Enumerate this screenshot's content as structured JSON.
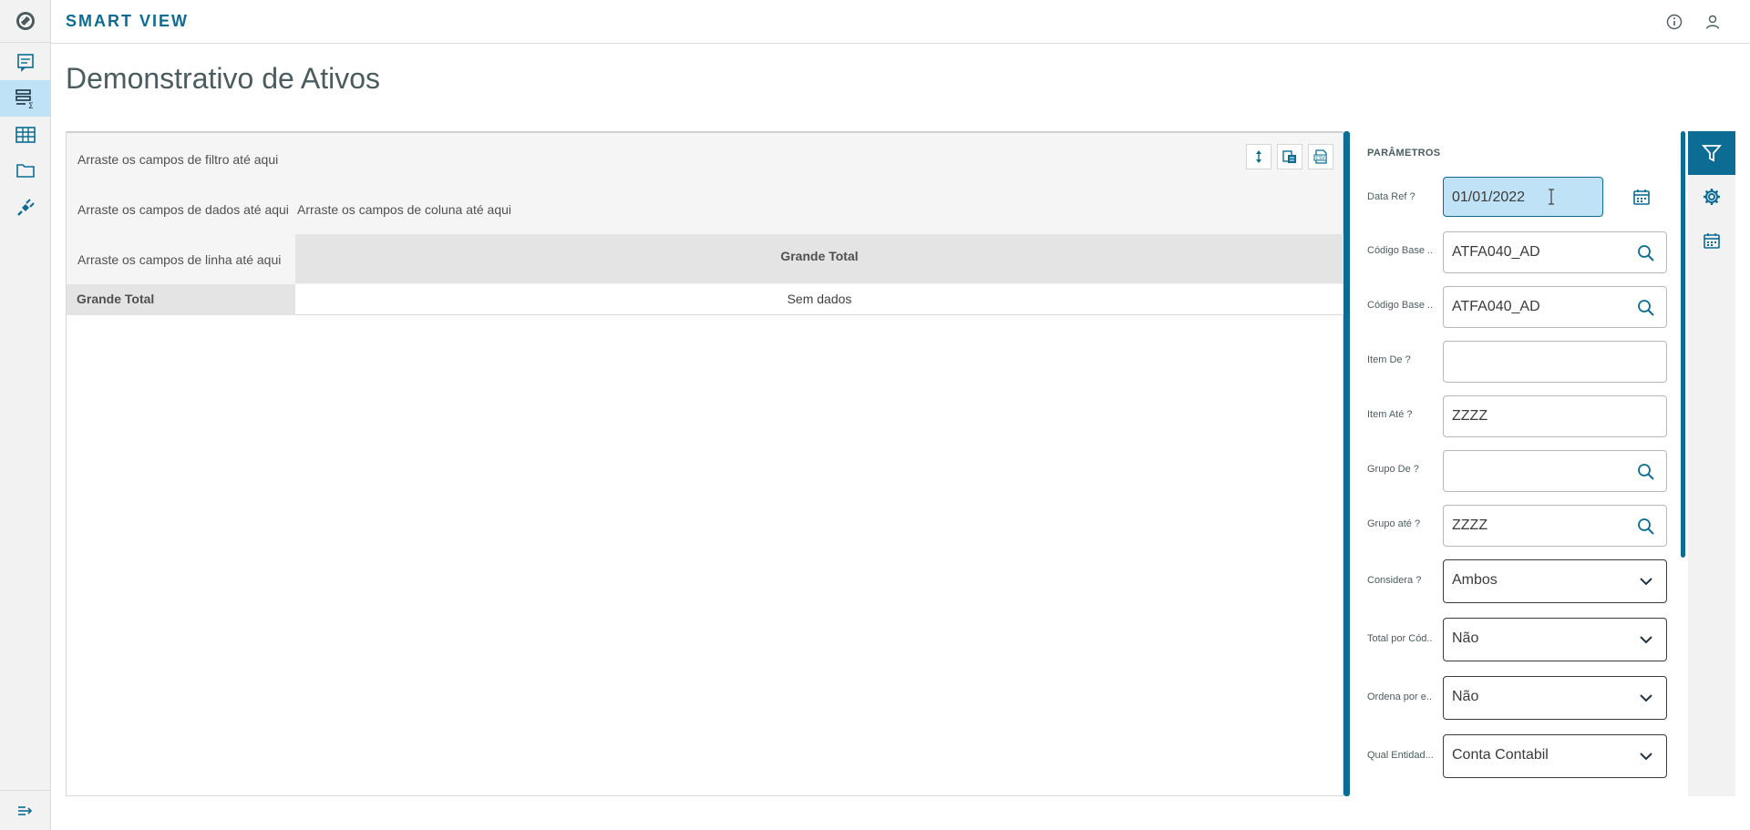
{
  "app": {
    "brand": "SMART VIEW"
  },
  "rail": {
    "items": [
      {
        "icon": "report-icon",
        "active": false
      },
      {
        "icon": "analysis-icon",
        "active": true
      },
      {
        "icon": "table-icon",
        "active": false
      },
      {
        "icon": "folder-icon",
        "active": false
      },
      {
        "icon": "plug-icon",
        "active": false
      }
    ],
    "bottom_icon": "expand-menu-icon"
  },
  "topbar": {
    "icons": [
      "info-icon",
      "user-icon"
    ]
  },
  "page": {
    "title": "Demonstrativo de Ativos"
  },
  "pivot": {
    "filter_drop": "Arraste os campos de filtro até aqui",
    "data_drop": "Arraste os campos de dados até aqui",
    "column_drop": "Arraste os campos de coluna até aqui",
    "row_drop": "Arraste os campos de linha até aqui",
    "grand_total_col": "Grande Total",
    "grand_total_row": "Grande Total",
    "no_data": "Sem dados",
    "tools": [
      "field-chooser-icon",
      "export-icon",
      "csv-icon"
    ]
  },
  "params": {
    "title": "PARÂMETROS",
    "fields": [
      {
        "label": "Data Ref ?",
        "value": "01/01/2022",
        "kind": "date"
      },
      {
        "label": "Código Base ...",
        "value": "ATFA040_AD",
        "kind": "lookup"
      },
      {
        "label": "Código Base ...",
        "value": "ATFA040_AD",
        "kind": "lookup"
      },
      {
        "label": "Item De ?",
        "value": "",
        "kind": "text"
      },
      {
        "label": "Item Até ?",
        "value": "ZZZZ",
        "kind": "text"
      },
      {
        "label": "Grupo De ?",
        "value": "",
        "kind": "lookup"
      },
      {
        "label": "Grupo até ?",
        "value": "ZZZZ",
        "kind": "lookup"
      },
      {
        "label": "Considera ?",
        "value": "Ambos",
        "kind": "select"
      },
      {
        "label": "Total por Cód...",
        "value": "Não",
        "kind": "select"
      },
      {
        "label": "Ordena por e...",
        "value": "Não",
        "kind": "select"
      },
      {
        "label": "Qual Entidad...",
        "value": "Conta Contabil",
        "kind": "select"
      }
    ]
  },
  "side_tabs": [
    "filter-icon",
    "settings-icon",
    "calendar-icon"
  ],
  "colors": {
    "accent": "#0c6c94",
    "active_bg": "#bfe2f6",
    "text": "#4a5c60"
  }
}
